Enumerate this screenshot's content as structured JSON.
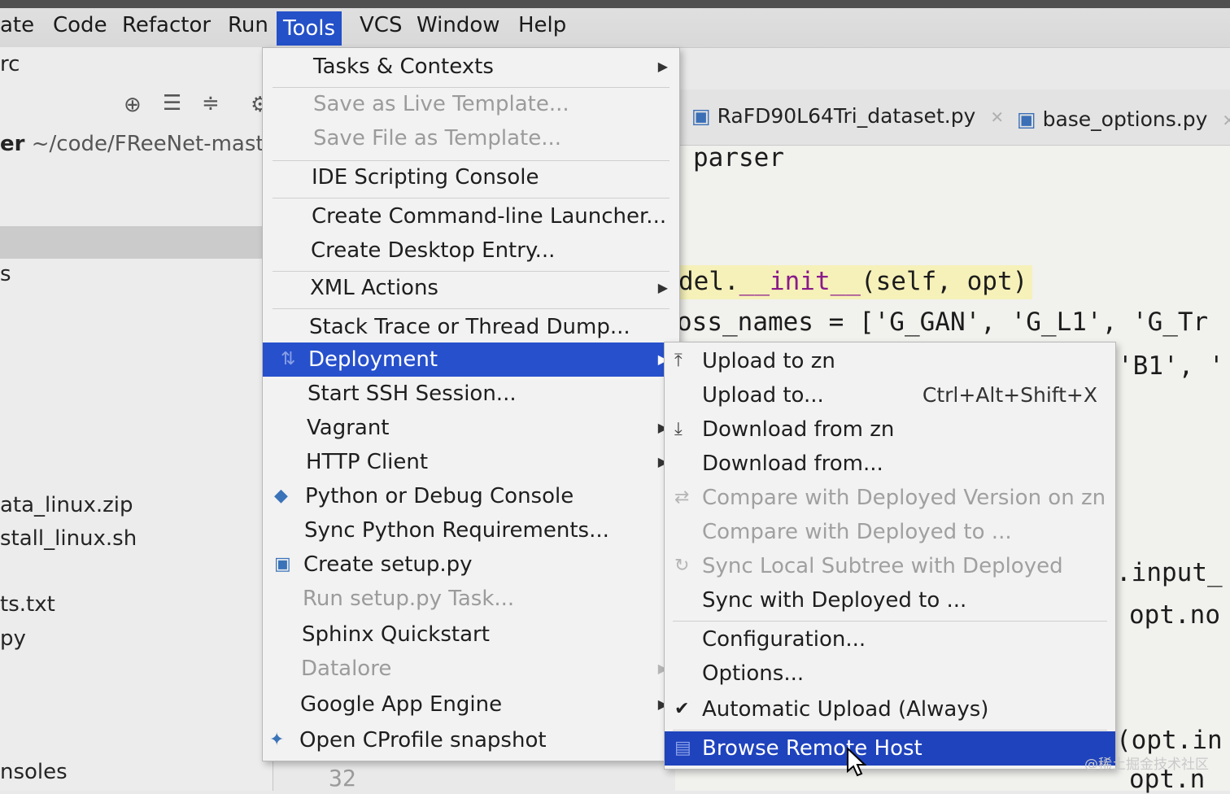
{
  "menubar": {
    "items": [
      "ate",
      "Code",
      "Refactor",
      "Run",
      "Tools",
      "VCS",
      "Window",
      "Help"
    ],
    "active": "Tools"
  },
  "left_panel": {
    "row_rc": "rc",
    "project_label": "er",
    "project_path": "~/code/FReeNet-master",
    "row_s": "s",
    "files": [
      "ata_linux.zip",
      "stall_linux.sh",
      "ts.txt",
      "py",
      "nsoles"
    ]
  },
  "editor": {
    "tabs": [
      {
        "label": "RaFD90L64Tri_dataset.py"
      },
      {
        "label": "base_options.py"
      }
    ],
    "code_lines": {
      "l1": "parser",
      "l2_a": "del.",
      "l2_b": "__init__",
      "l2_c": "(self, opt)",
      "l3": "oss_names = ['G_GAN', 'G_L1', 'G_Tr",
      "l4": "'B1', '",
      "l5": ".input_",
      "l6": "opt.no",
      "l7": "(opt.in",
      "l8": "opt.n"
    },
    "line_number": "32"
  },
  "tools_menu": {
    "items": [
      {
        "label": "Tasks & Contexts",
        "submenu": true
      },
      {
        "label": "Save as Live Template...",
        "disabled": true
      },
      {
        "label": "Save File as Template...",
        "disabled": true
      },
      {
        "label": "IDE Scripting Console"
      },
      {
        "label": "Create Command-line Launcher..."
      },
      {
        "label": "Create Desktop Entry..."
      },
      {
        "label": "XML Actions",
        "submenu": true
      },
      {
        "label": "Stack Trace or Thread Dump..."
      },
      {
        "label": "Deployment",
        "submenu": true,
        "selected": true
      },
      {
        "label": "Start SSH Session..."
      },
      {
        "label": "Vagrant",
        "submenu": true
      },
      {
        "label": "HTTP Client",
        "submenu": true
      },
      {
        "label": "Python or Debug Console",
        "icon": "python-icon"
      },
      {
        "label": "Sync Python Requirements..."
      },
      {
        "label": "Create setup.py",
        "icon": "python-file-icon"
      },
      {
        "label": "Run setup.py Task...",
        "disabled": true
      },
      {
        "label": "Sphinx Quickstart"
      },
      {
        "label": "Datalore",
        "submenu": true,
        "disabled": true
      },
      {
        "label": "Google App Engine",
        "submenu": true
      },
      {
        "label": "Open CProfile snapshot",
        "icon": "profile-icon"
      }
    ]
  },
  "deployment_menu": {
    "items": [
      {
        "label": "Upload to zn",
        "icon": "upload-icon"
      },
      {
        "label": "Upload to...",
        "shortcut": "Ctrl+Alt+Shift+X"
      },
      {
        "label": "Download from zn",
        "icon": "download-icon"
      },
      {
        "label": "Download from..."
      },
      {
        "label": "Compare with Deployed Version on zn",
        "icon": "compare-icon",
        "disabled": true
      },
      {
        "label": "Compare with Deployed to ...",
        "disabled": true
      },
      {
        "label": "Sync Local Subtree with Deployed",
        "icon": "sync-icon",
        "disabled": true
      },
      {
        "label": "Sync with Deployed to ..."
      },
      {
        "label": "Configuration..."
      },
      {
        "label": "Options..."
      },
      {
        "label": "Automatic Upload (Always)",
        "icon": "checkmark-icon"
      },
      {
        "label": "Browse Remote Host",
        "icon": "server-icon",
        "selected": true
      }
    ]
  },
  "watermark": "@稀土掘金技术社区",
  "colors": {
    "selection": "#2750cc",
    "submenu_selection": "#1f43bd",
    "menu_bg": "#f2f2f2",
    "code_string": "#1e7a2a"
  }
}
